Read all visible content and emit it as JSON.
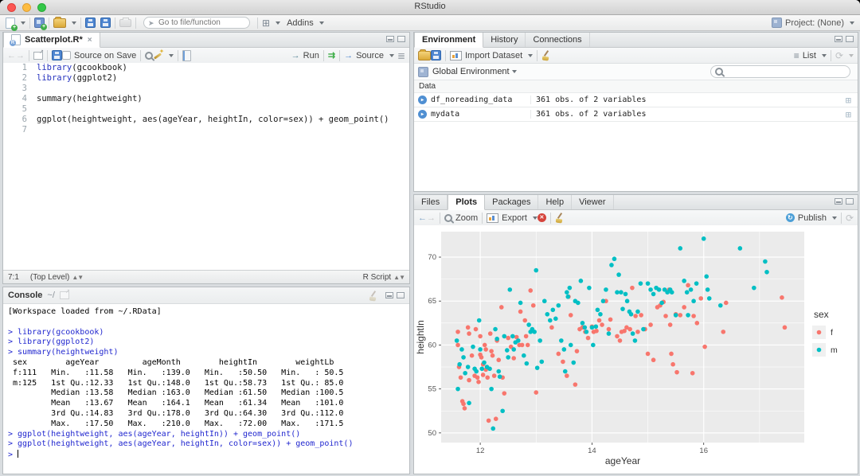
{
  "titlebar": {
    "title": "RStudio"
  },
  "toolbar": {
    "goto_placeholder": "Go to file/function",
    "addins_label": "Addins",
    "project_label": "Project: (None)"
  },
  "source_pane": {
    "tab_title": "Scatterplot.R*",
    "source_on_save_label": "Source on Save",
    "run_label": "Run",
    "source_label": "Source",
    "status_position": "7:1",
    "status_scope": "(Top Level)",
    "status_type": "R Script",
    "code_lines": [
      {
        "n": "1",
        "segs": [
          {
            "t": "library",
            "c": "kw"
          },
          {
            "t": "(gcookbook)",
            "c": "pl"
          }
        ]
      },
      {
        "n": "2",
        "segs": [
          {
            "t": "library",
            "c": "kw"
          },
          {
            "t": "(ggplot2)",
            "c": "pl"
          }
        ]
      },
      {
        "n": "3",
        "segs": []
      },
      {
        "n": "4",
        "segs": [
          {
            "t": "summary(heightweight)",
            "c": "pl"
          }
        ]
      },
      {
        "n": "5",
        "segs": []
      },
      {
        "n": "6",
        "segs": [
          {
            "t": "ggplot(heightweight, aes(ageYear, heightIn, color=sex)) + geom_point()",
            "c": "pl"
          }
        ]
      },
      {
        "n": "7",
        "segs": []
      }
    ]
  },
  "console_pane": {
    "title": "Console",
    "path": "~/",
    "lines": [
      {
        "text": "[Workspace loaded from ~/.RData]",
        "type": "out"
      },
      {
        "text": "",
        "type": "out"
      },
      {
        "text": "> library(gcookbook)",
        "type": "in"
      },
      {
        "text": "> library(ggplot2)",
        "type": "in"
      },
      {
        "text": "> summary(heightweight)",
        "type": "in"
      },
      {
        "text": " sex        ageYear         ageMonth        heightIn        weightLb    ",
        "type": "out"
      },
      {
        "text": " f:111   Min.   :11.58   Min.   :139.0   Min.   :50.50   Min.   : 50.5  ",
        "type": "out"
      },
      {
        "text": " m:125   1st Qu.:12.33   1st Qu.:148.0   1st Qu.:58.73   1st Qu.: 85.0  ",
        "type": "out"
      },
      {
        "text": "         Median :13.58   Median :163.0   Median :61.50   Median :100.5  ",
        "type": "out"
      },
      {
        "text": "         Mean   :13.67   Mean   :164.1   Mean   :61.34   Mean   :101.0  ",
        "type": "out"
      },
      {
        "text": "         3rd Qu.:14.83   3rd Qu.:178.0   3rd Qu.:64.30   3rd Qu.:112.0  ",
        "type": "out"
      },
      {
        "text": "         Max.   :17.50   Max.   :210.0   Max.   :72.00   Max.   :171.5  ",
        "type": "out"
      },
      {
        "text": "> ggplot(heightweight, aes(ageYear, heightIn)) + geom_point()",
        "type": "in"
      },
      {
        "text": "> ggplot(heightweight, aes(ageYear, heightIn, color=sex)) + geom_point()",
        "type": "in"
      },
      {
        "text": "> ",
        "type": "prompt"
      }
    ]
  },
  "environment_pane": {
    "tabs": [
      {
        "label": "Environment",
        "active": true
      },
      {
        "label": "History",
        "active": false
      },
      {
        "label": "Connections",
        "active": false
      }
    ],
    "import_label": "Import Dataset",
    "list_label": "List",
    "environment_label": "Global Environment",
    "section_label": "Data",
    "objects": [
      {
        "name": "df_noreading_data",
        "desc": "361 obs. of 2 variables"
      },
      {
        "name": "mydata",
        "desc": "361 obs. of 2 variables"
      }
    ]
  },
  "plots_pane": {
    "tabs": [
      {
        "label": "Files",
        "active": false
      },
      {
        "label": "Plots",
        "active": true
      },
      {
        "label": "Packages",
        "active": false
      },
      {
        "label": "Help",
        "active": false
      },
      {
        "label": "Viewer",
        "active": false
      }
    ],
    "zoom_label": "Zoom",
    "export_label": "Export",
    "publish_label": "Publish"
  },
  "chart_data": {
    "type": "scatter",
    "title": "",
    "xlabel": "ageYear",
    "ylabel": "heightIn",
    "xlim": [
      11.3,
      17.8
    ],
    "ylim": [
      48.9,
      72.9
    ],
    "xticks": [
      12,
      14,
      16
    ],
    "yticks": [
      50,
      55,
      60,
      65,
      70
    ],
    "x_minor": [
      13,
      15,
      17
    ],
    "y_minor": [
      52.5,
      57.5,
      62.5,
      67.5
    ],
    "panel_bg": "#EBEBEB",
    "grid_color": "#FFFFFF",
    "grid": true,
    "legend": {
      "title": "sex",
      "position": "right"
    },
    "series": [
      {
        "name": "f",
        "color": "#F8766D",
        "points": [
          [
            11.6,
            61.5
          ],
          [
            11.6,
            60.0
          ],
          [
            11.62,
            57.5
          ],
          [
            11.65,
            56.3
          ],
          [
            11.68,
            53.6
          ],
          [
            11.7,
            53.3
          ],
          [
            11.72,
            52.8
          ],
          [
            11.78,
            62.0
          ],
          [
            11.8,
            61.3
          ],
          [
            11.8,
            56.0
          ],
          [
            11.85,
            58.8
          ],
          [
            11.9,
            56.5
          ],
          [
            11.92,
            61.8
          ],
          [
            11.95,
            56.3
          ],
          [
            11.97,
            55.8
          ],
          [
            12.0,
            61.0
          ],
          [
            12.0,
            58.9
          ],
          [
            12.02,
            58.6
          ],
          [
            12.05,
            57.8
          ],
          [
            12.05,
            56.6
          ],
          [
            12.08,
            60.0
          ],
          [
            12.1,
            59.5
          ],
          [
            12.1,
            57.2
          ],
          [
            12.13,
            56.3
          ],
          [
            12.15,
            51.4
          ],
          [
            12.18,
            61.3
          ],
          [
            12.2,
            59.3
          ],
          [
            12.22,
            58.8
          ],
          [
            12.25,
            56.5
          ],
          [
            12.28,
            51.6
          ],
          [
            12.3,
            60.5
          ],
          [
            12.33,
            58.3
          ],
          [
            12.38,
            64.3
          ],
          [
            12.4,
            56.3
          ],
          [
            12.43,
            54.5
          ],
          [
            12.5,
            60.8
          ],
          [
            12.55,
            59.8
          ],
          [
            12.6,
            58.5
          ],
          [
            12.65,
            60.9
          ],
          [
            12.7,
            60.0
          ],
          [
            12.72,
            63.8
          ],
          [
            12.75,
            60.0
          ],
          [
            12.8,
            62.8
          ],
          [
            12.82,
            61.0
          ],
          [
            12.85,
            60.0
          ],
          [
            12.9,
            66.2
          ],
          [
            12.95,
            64.5
          ],
          [
            13.0,
            54.6
          ],
          [
            13.28,
            62.0
          ],
          [
            13.4,
            59.0
          ],
          [
            13.48,
            58.1
          ],
          [
            13.55,
            56.5
          ],
          [
            13.58,
            65.5
          ],
          [
            13.62,
            63.4
          ],
          [
            13.7,
            55.5
          ],
          [
            13.73,
            59.3
          ],
          [
            13.78,
            61.8
          ],
          [
            13.83,
            62.0
          ],
          [
            13.88,
            61.5
          ],
          [
            13.93,
            60.8
          ],
          [
            14.0,
            62.1
          ],
          [
            14.03,
            61.5
          ],
          [
            14.08,
            61.6
          ],
          [
            14.13,
            62.8
          ],
          [
            14.18,
            62.3
          ],
          [
            14.25,
            65.0
          ],
          [
            14.3,
            61.8
          ],
          [
            14.33,
            62.9
          ],
          [
            14.45,
            61.0
          ],
          [
            14.5,
            60.5
          ],
          [
            14.53,
            61.5
          ],
          [
            14.58,
            61.6
          ],
          [
            14.62,
            62.0
          ],
          [
            14.68,
            61.8
          ],
          [
            14.72,
            66.5
          ],
          [
            14.78,
            63.3
          ],
          [
            14.82,
            61.5
          ],
          [
            14.88,
            63.4
          ],
          [
            14.95,
            61.8
          ],
          [
            15.0,
            59.0
          ],
          [
            15.05,
            62.3
          ],
          [
            15.1,
            58.3
          ],
          [
            15.17,
            64.3
          ],
          [
            15.22,
            64.5
          ],
          [
            15.28,
            64.9
          ],
          [
            15.32,
            63.3
          ],
          [
            15.38,
            66.3
          ],
          [
            15.4,
            62.3
          ],
          [
            15.42,
            59.0
          ],
          [
            15.45,
            57.8
          ],
          [
            15.5,
            63.5
          ],
          [
            15.52,
            56.9
          ],
          [
            15.58,
            63.4
          ],
          [
            15.65,
            64.3
          ],
          [
            15.72,
            66.8
          ],
          [
            15.8,
            56.8
          ],
          [
            15.82,
            63.3
          ],
          [
            15.88,
            62.5
          ],
          [
            15.95,
            65.3
          ],
          [
            16.02,
            59.8
          ],
          [
            16.35,
            61.5
          ],
          [
            16.4,
            64.8
          ],
          [
            17.4,
            65.4
          ],
          [
            17.45,
            62.0
          ]
        ]
      },
      {
        "name": "m",
        "color": "#00BFC4",
        "points": [
          [
            11.58,
            60.5
          ],
          [
            11.6,
            55.0
          ],
          [
            11.63,
            57.8
          ],
          [
            11.67,
            59.5
          ],
          [
            11.7,
            58.6
          ],
          [
            11.73,
            56.8
          ],
          [
            11.78,
            57.5
          ],
          [
            11.8,
            53.4
          ],
          [
            11.87,
            59.8
          ],
          [
            11.9,
            57.3
          ],
          [
            11.93,
            57.0
          ],
          [
            11.98,
            62.8
          ],
          [
            12.0,
            59.5
          ],
          [
            12.03,
            57.3
          ],
          [
            12.07,
            58.0
          ],
          [
            12.12,
            57.5
          ],
          [
            12.17,
            57.3
          ],
          [
            12.2,
            55.0
          ],
          [
            12.23,
            50.5
          ],
          [
            12.27,
            61.8
          ],
          [
            12.3,
            60.7
          ],
          [
            12.33,
            57.0
          ],
          [
            12.35,
            56.4
          ],
          [
            12.4,
            52.5
          ],
          [
            12.43,
            61.0
          ],
          [
            12.48,
            59.4
          ],
          [
            12.5,
            58.6
          ],
          [
            12.53,
            66.3
          ],
          [
            12.58,
            61.0
          ],
          [
            12.6,
            59.5
          ],
          [
            12.63,
            60.3
          ],
          [
            12.68,
            60.5
          ],
          [
            12.72,
            64.8
          ],
          [
            12.78,
            58.8
          ],
          [
            12.83,
            57.9
          ],
          [
            12.87,
            62.3
          ],
          [
            12.9,
            61.5
          ],
          [
            12.93,
            61.8
          ],
          [
            12.97,
            61.5
          ],
          [
            13.0,
            68.5
          ],
          [
            13.02,
            57.4
          ],
          [
            13.07,
            60.5
          ],
          [
            13.1,
            58.1
          ],
          [
            13.15,
            65.0
          ],
          [
            13.2,
            63.5
          ],
          [
            13.25,
            62.8
          ],
          [
            13.3,
            64.0
          ],
          [
            13.35,
            63.0
          ],
          [
            13.4,
            64.5
          ],
          [
            13.45,
            60.5
          ],
          [
            13.5,
            59.5
          ],
          [
            13.52,
            57.0
          ],
          [
            13.55,
            66.0
          ],
          [
            13.57,
            65.5
          ],
          [
            13.6,
            66.5
          ],
          [
            13.62,
            60.0
          ],
          [
            13.67,
            58.0
          ],
          [
            13.7,
            65.0
          ],
          [
            13.75,
            64.8
          ],
          [
            13.8,
            67.3
          ],
          [
            13.83,
            62.5
          ],
          [
            13.87,
            62.0
          ],
          [
            13.9,
            61.5
          ],
          [
            13.95,
            66.5
          ],
          [
            14.0,
            62.0
          ],
          [
            14.02,
            60.0
          ],
          [
            14.07,
            62.1
          ],
          [
            14.1,
            64.0
          ],
          [
            14.15,
            63.5
          ],
          [
            14.2,
            65.0
          ],
          [
            14.25,
            66.3
          ],
          [
            14.3,
            61.3
          ],
          [
            14.35,
            69.1
          ],
          [
            14.4,
            69.8
          ],
          [
            14.45,
            66.0
          ],
          [
            14.48,
            68.0
          ],
          [
            14.52,
            66.0
          ],
          [
            14.55,
            64.1
          ],
          [
            14.6,
            65.8
          ],
          [
            14.63,
            65.0
          ],
          [
            14.67,
            63.8
          ],
          [
            14.7,
            63.5
          ],
          [
            14.73,
            61.3
          ],
          [
            14.77,
            60.5
          ],
          [
            14.82,
            63.8
          ],
          [
            14.87,
            67.0
          ],
          [
            14.92,
            61.8
          ],
          [
            15.0,
            67.0
          ],
          [
            15.05,
            66.3
          ],
          [
            15.1,
            65.8
          ],
          [
            15.15,
            66.5
          ],
          [
            15.2,
            66.3
          ],
          [
            15.25,
            64.8
          ],
          [
            15.3,
            66.3
          ],
          [
            15.35,
            66.0
          ],
          [
            15.4,
            66.3
          ],
          [
            15.43,
            66.0
          ],
          [
            15.5,
            63.4
          ],
          [
            15.58,
            71.0
          ],
          [
            15.65,
            67.3
          ],
          [
            15.7,
            66.0
          ],
          [
            15.72,
            63.4
          ],
          [
            15.77,
            66.3
          ],
          [
            15.82,
            65.0
          ],
          [
            15.87,
            67.0
          ],
          [
            16.0,
            72.1
          ],
          [
            16.05,
            67.8
          ],
          [
            16.07,
            66.3
          ],
          [
            16.1,
            65.3
          ],
          [
            16.3,
            64.5
          ],
          [
            16.65,
            71.0
          ],
          [
            16.9,
            66.5
          ],
          [
            17.1,
            69.5
          ],
          [
            17.13,
            68.3
          ]
        ]
      }
    ]
  }
}
